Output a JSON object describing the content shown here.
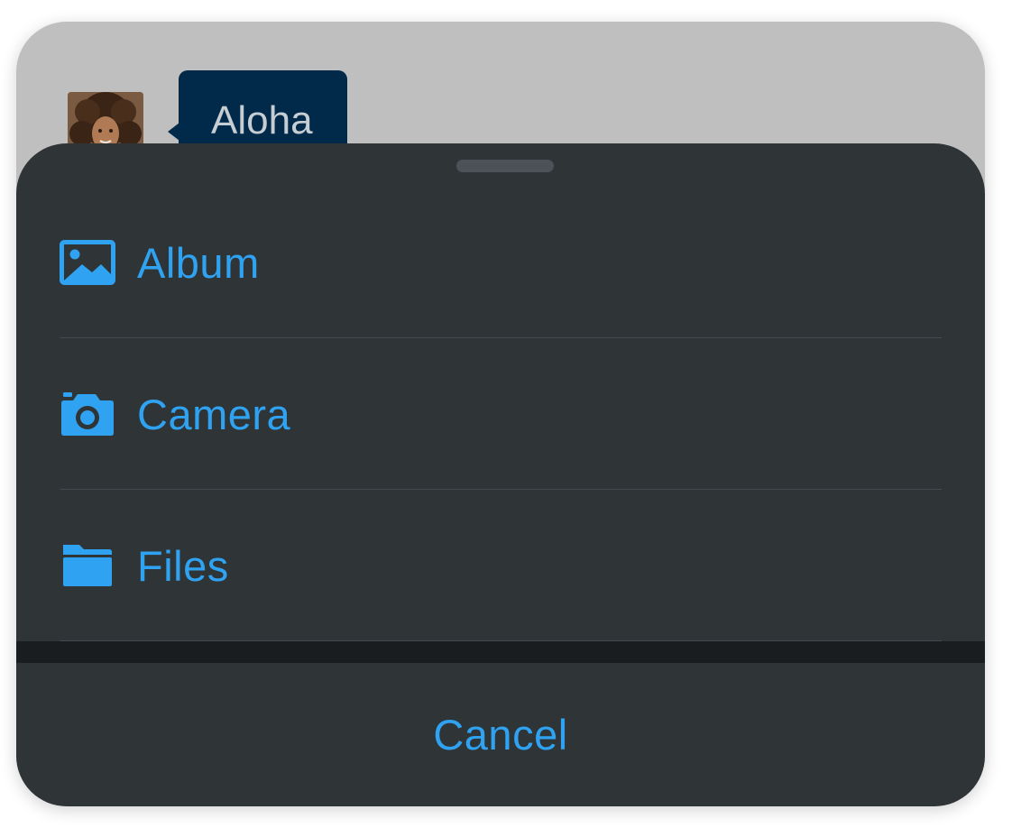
{
  "chat": {
    "message": "Aloha"
  },
  "sheet": {
    "options": [
      {
        "label": "Album",
        "icon": "image-icon"
      },
      {
        "label": "Camera",
        "icon": "camera-icon"
      },
      {
        "label": "Files",
        "icon": "folder-icon"
      }
    ],
    "cancel_label": "Cancel"
  },
  "colors": {
    "accent": "#2fa3f2",
    "sheet_background": "#2f3437",
    "bubble_background": "#00294a",
    "backdrop": "#bfbfbf"
  }
}
